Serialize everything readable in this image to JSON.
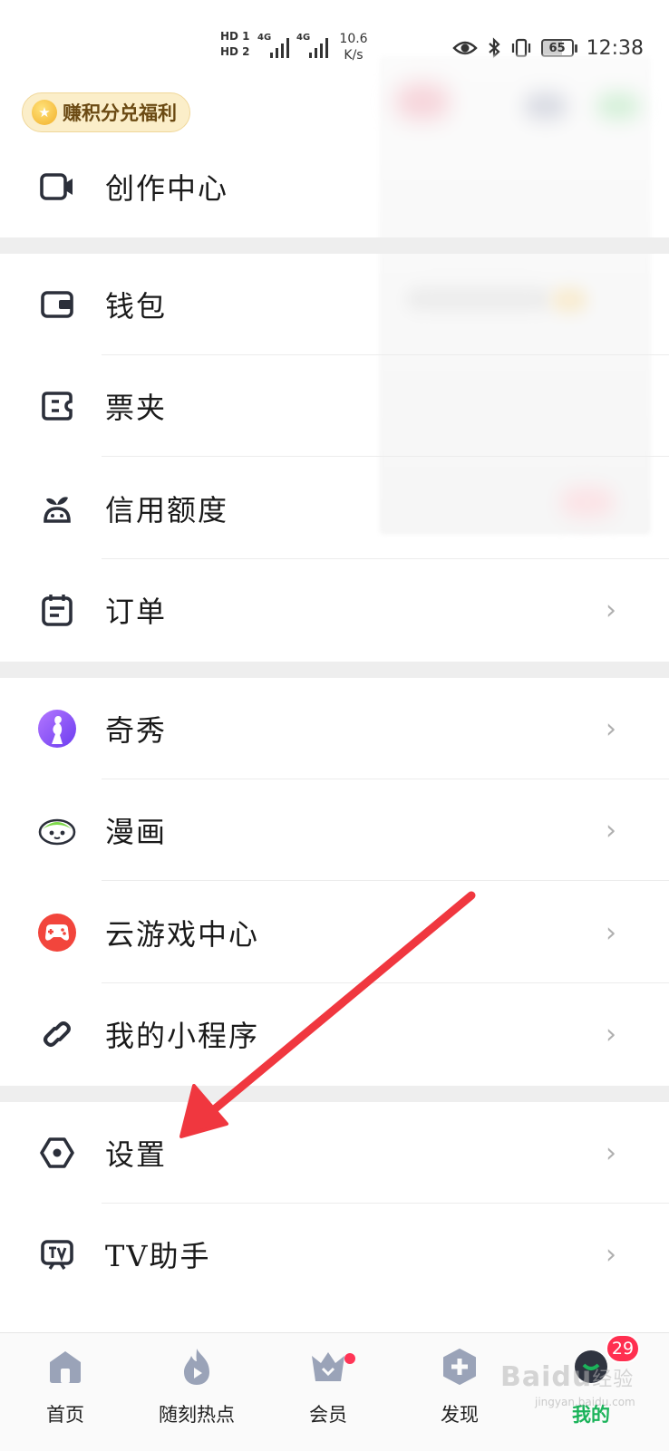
{
  "status_bar": {
    "sim1": "HD 1",
    "sim2": "HD 2",
    "net1": "4G",
    "net2": "4G",
    "speed_value": "10.6",
    "speed_unit": "K/s",
    "battery": "65",
    "time": "12:38"
  },
  "points_badge": {
    "label": "赚积分兑福利"
  },
  "menu": {
    "creation_center": "创作中心",
    "wallet": "钱包",
    "tickets": "票夹",
    "credit": "信用额度",
    "orders": "订单",
    "qixiu": "奇秀",
    "comics": "漫画",
    "cloud_games": "云游戏中心",
    "mini_programs": "我的小程序",
    "settings": "设置",
    "tv_assistant": "TV助手"
  },
  "chevron": "›",
  "bottom_nav": {
    "home": "首页",
    "hot": "随刻热点",
    "vip": "会员",
    "discover": "发现",
    "mine": "我的",
    "mine_badge": "29"
  },
  "watermark": {
    "brand": "Baidu",
    "suffix": "经验",
    "url": "jingyan.baidu.com"
  },
  "colors": {
    "accent_green": "#1bb35a",
    "badge_red": "#ff2f50",
    "arrow_red": "#f0373f"
  }
}
